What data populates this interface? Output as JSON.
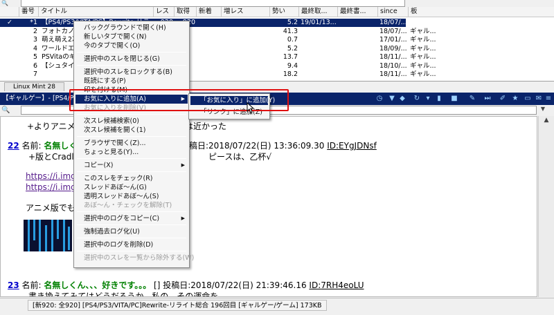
{
  "search_top": {
    "icon": "search-icon"
  },
  "thread_list": {
    "columns": [
      "番号",
      "タイトル",
      "レス",
      "取得",
      "新着",
      "増レス",
      "勢い",
      "最終取...",
      "最終書...",
      "since",
      "板"
    ],
    "rows": [
      {
        "check": "✓",
        "num": "*1",
        "title": "【PS4/PS3/VITA/PC】Rewrite-リライ",
        "res": "920",
        "got": "920",
        "new": "",
        "inc": "",
        "power": "5.2",
        "last_get": "19/01/13...",
        "last_write": "",
        "since": "18/07/...",
        "board": "ギャル..."
      },
      {
        "check": "",
        "num": "2",
        "title": "フォトカノで",
        "res": "",
        "got": "",
        "new": "",
        "inc": "",
        "power": "41.3",
        "last_get": "",
        "last_write": "",
        "since": "18/07/...",
        "board": "ギャル..."
      },
      {
        "check": "",
        "num": "3",
        "title": "萌え萌え2次",
        "res": "",
        "got": "",
        "new": "",
        "inc": "",
        "power": "0.7",
        "last_get": "",
        "last_write": "",
        "since": "17/01/...",
        "board": "ギャル..."
      },
      {
        "check": "",
        "num": "4",
        "title": "ワールドエン",
        "res": "",
        "got": "",
        "new": "",
        "inc": "",
        "power": "5.2",
        "last_get": "",
        "last_write": "",
        "since": "18/09/...",
        "board": "ギャル..."
      },
      {
        "check": "",
        "num": "5",
        "title": "PSVitaのギ",
        "res": "",
        "got": "",
        "new": "",
        "inc": "",
        "power": "13.7",
        "last_get": "",
        "last_write": "",
        "since": "18/11/...",
        "board": "ギャル..."
      },
      {
        "check": "",
        "num": "6",
        "title": "【シュタインズ・ゲ",
        "res": "",
        "got": "",
        "new": "",
        "inc": "",
        "power": "9.4",
        "last_get": "",
        "last_write": "",
        "since": "18/10/...",
        "board": "ギャル..."
      },
      {
        "check": "",
        "num": "7",
        "title": "",
        "res": "",
        "got": "",
        "new": "",
        "inc": "",
        "power": "18.2",
        "last_get": "",
        "last_write": "",
        "since": "18/11/...",
        "board": "ギャル..."
      }
    ]
  },
  "tabs": {
    "active": "Linux Mint 28"
  },
  "thread_bar": {
    "title": "【ギャルゲー】- [PS4/P"
  },
  "content": {
    "line1": "+よりアニメ",
    "line1b": "には近かった",
    "post22": {
      "num": "22",
      "name_label": "名前:",
      "name": "名無しくん",
      "date": "稿日:2018/07/22(日) 13:36:09.30",
      "id_label": "ID:",
      "id": "EYgJDNsf"
    },
    "line22a": "+版とCradles",
    "line22b": "ピースは、乙杯√",
    "link1": "https://i.imgu",
    "link2": "https://i.imgu",
    "line_anime": "アニメ版でも",
    "post23": {
      "num": "23",
      "name_label": "名前:",
      "name": "名無しくん、、、好きです。。。",
      "date": "[] 投稿日:2018/07/22(日) 21:39:46.16",
      "id_label": "ID:",
      "id": "7RH4eoLU"
    },
    "line23": "書き換えてみてはどうだろうか、私の、その運命を"
  },
  "status_bar": {
    "text": "[新920: 全920] [PS4/PS3/VITA/PC]Rewrite-リライト総合 196回目   [ギャルゲー/ゲーム]  173KB"
  },
  "context_menu": {
    "items": [
      {
        "label": "バックグラウンドで開く(H)",
        "disabled": false
      },
      {
        "label": "新しいタブで開く(N)",
        "disabled": false
      },
      {
        "label": "今のタブで開く(O)",
        "disabled": false
      },
      {
        "sep": true
      },
      {
        "label": "選択中のスレを閉じる(G)",
        "disabled": false
      },
      {
        "sep": true
      },
      {
        "label": "選択中のスレをロックする(B)",
        "disabled": false
      },
      {
        "label": "既読にする(P)",
        "disabled": false
      },
      {
        "label": "印を付ける(M)",
        "disabled": false
      },
      {
        "label": "お気に入りに追加(A)",
        "disabled": false,
        "highlight": true,
        "submenu": true
      },
      {
        "label": "お気に入りを削除(V)",
        "disabled": true
      },
      {
        "sep": true
      },
      {
        "label": "次スレ候補検索(0)",
        "disabled": false
      },
      {
        "label": "次スレ候補を開く(1)",
        "disabled": false
      },
      {
        "sep": true
      },
      {
        "label": "ブラウザで開く(Z)...",
        "disabled": false
      },
      {
        "label": "ちょっと見る(Y)...",
        "disabled": false
      },
      {
        "sep": true
      },
      {
        "label": "コピー(X)",
        "disabled": false,
        "submenu": true
      },
      {
        "sep": true
      },
      {
        "label": "このスレをチェック(R)",
        "disabled": false
      },
      {
        "label": "スレッドあぼ〜ん(G)",
        "disabled": false
      },
      {
        "label": "透明スレッドあぼ〜ん(S)",
        "disabled": false
      },
      {
        "label": "あぼ〜ん・チェックを解除(T)",
        "disabled": true
      },
      {
        "sep": true
      },
      {
        "label": "選択中のログをコピー(C)",
        "disabled": false,
        "submenu": true
      },
      {
        "sep": true
      },
      {
        "label": "強制過去ログ化(U)",
        "disabled": false
      },
      {
        "sep": true
      },
      {
        "label": "選択中のログを削除(D)",
        "disabled": false
      },
      {
        "sep": true
      },
      {
        "label": "選択中のスレを一覧から除外する(W)",
        "disabled": true
      }
    ]
  },
  "submenu": {
    "items": [
      {
        "label": "「お気に入り」に追加(Y)",
        "highlight": true
      },
      {
        "label": "「リンク」に追加(Z)",
        "highlight": false
      }
    ]
  },
  "colors": {
    "selection": "#0a246a",
    "highlight_box": "#e01010",
    "name_green": "#008000",
    "link_blue": "#0000cc"
  }
}
